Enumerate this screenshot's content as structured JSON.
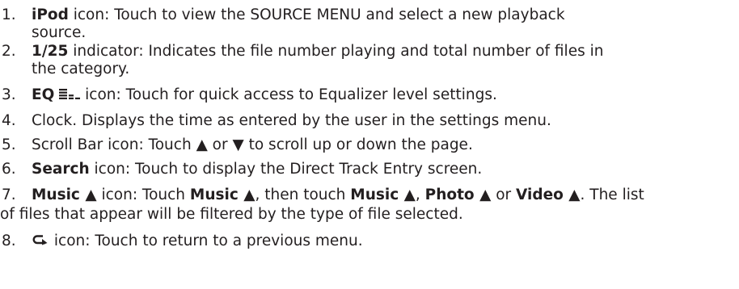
{
  "items": [
    {
      "num": "1.",
      "bold": "iPod",
      "line1": " icon: Touch to view the SOURCE MENU and select a new playback",
      "line2": "source."
    },
    {
      "num": "2.",
      "bold": "1/25",
      "line1": " indicator: Indicates the file number playing and total number of files in",
      "line2": "the category."
    },
    {
      "num": "3.",
      "bold": "EQ",
      "icon": "equalizer-icon",
      "text": " icon: Touch for quick access to Equalizer level settings."
    },
    {
      "num": "4.",
      "text": "Clock. Displays the time as entered by the user in the settings menu."
    },
    {
      "num": "5.",
      "text_a": "Scroll Bar icon: Touch ",
      "up": "▲",
      "text_b": " or ",
      "down": "▼",
      "text_c": " to scroll up or down the page."
    },
    {
      "num": "6.",
      "bold": "Search",
      "text": " icon: Touch to display the Direct Track Entry screen."
    },
    {
      "num": "7.",
      "music": "Music ▲",
      "t1": " icon: Touch ",
      "t2": ", then touch ",
      "t3": ", ",
      "photo": "Photo ▲",
      "t4": " or ",
      "video": "Video ▲",
      "t5": ". The list",
      "line2": "of files that appear will be filtered by the type of file selected."
    },
    {
      "num": "8.",
      "icon": "return-arrow-icon",
      "text": " icon: Touch to return to a previous menu."
    }
  ]
}
